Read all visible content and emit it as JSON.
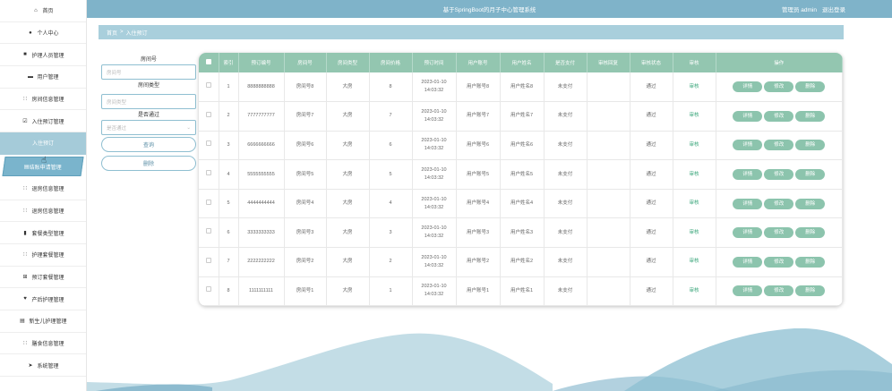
{
  "header": {
    "title": "基于SpringBoot的月子中心管理系统",
    "user_label": "管理员 admin",
    "logout_label": "退出登录"
  },
  "sidebar": {
    "items": [
      {
        "label": "首页",
        "icon": "home-icon"
      },
      {
        "label": "个人中心",
        "icon": "person-icon"
      },
      {
        "label": "护理人员管理",
        "icon": "briefcase-icon"
      },
      {
        "label": "用户管理",
        "icon": "monitor-icon"
      },
      {
        "label": "房间信息管理",
        "icon": "grid-icon"
      },
      {
        "label": "入住预订管理",
        "icon": "check-square-icon"
      },
      {
        "label": "入住预订",
        "icon": ""
      },
      {
        "label": "结账申请管理",
        "icon": "doc-icon"
      },
      {
        "label": "退房信息管理",
        "icon": "grid-icon"
      },
      {
        "label": "退房信息管理",
        "icon": "grid-icon"
      },
      {
        "label": "套餐类型管理",
        "icon": "trash-icon"
      },
      {
        "label": "护理套餐管理",
        "icon": "grid-icon"
      },
      {
        "label": "预订套餐管理",
        "icon": "table-icon"
      },
      {
        "label": "产后护理管理",
        "icon": "heart-icon"
      },
      {
        "label": "新生儿护理管理",
        "icon": "doc-icon"
      },
      {
        "label": "膳食信息管理",
        "icon": "grid-icon"
      },
      {
        "label": "系统管理",
        "icon": "send-icon"
      }
    ]
  },
  "breadcrumb": {
    "home": "首页",
    "sep": ">",
    "current": "入住预订"
  },
  "search": {
    "room_no_label": "房间号",
    "room_no_placeholder": "房间号",
    "room_type_label": "房间类型",
    "room_type_placeholder": "房间类型",
    "approved_label": "是否通过",
    "approved_placeholder": "是否通过",
    "query_button": "查询",
    "delete_button": "删除"
  },
  "table": {
    "columns": [
      "索引",
      "预订编号",
      "房间号",
      "房间类型",
      "房间价格",
      "预订时间",
      "用户账号",
      "用户姓名",
      "是否支付",
      "审核回复",
      "审核状态",
      "审核",
      "操作"
    ],
    "rows": [
      {
        "index": "1",
        "booking_no": "8888888888",
        "room": "房间号8",
        "type": "大房",
        "price": "8",
        "date": "2023-01-10",
        "time": "14:03:32",
        "account": "用户账号8",
        "name": "用户姓名8",
        "paid": "未支付",
        "reply": "",
        "status": "通过",
        "audit": "审核"
      },
      {
        "index": "2",
        "booking_no": "7777777777",
        "room": "房间号7",
        "type": "大房",
        "price": "7",
        "date": "2023-01-10",
        "time": "14:03:32",
        "account": "用户账号7",
        "name": "用户姓名7",
        "paid": "未支付",
        "reply": "",
        "status": "通过",
        "audit": "审核"
      },
      {
        "index": "3",
        "booking_no": "6666666666",
        "room": "房间号6",
        "type": "大房",
        "price": "6",
        "date": "2023-01-10",
        "time": "14:03:32",
        "account": "用户账号6",
        "name": "用户姓名6",
        "paid": "未支付",
        "reply": "",
        "status": "通过",
        "audit": "审核"
      },
      {
        "index": "4",
        "booking_no": "5555555555",
        "room": "房间号5",
        "type": "大房",
        "price": "5",
        "date": "2023-01-10",
        "time": "14:03:32",
        "account": "用户账号5",
        "name": "用户姓名5",
        "paid": "未支付",
        "reply": "",
        "status": "通过",
        "audit": "审核"
      },
      {
        "index": "5",
        "booking_no": "4444444444",
        "room": "房间号4",
        "type": "大房",
        "price": "4",
        "date": "2023-01-10",
        "time": "14:03:32",
        "account": "用户账号4",
        "name": "用户姓名4",
        "paid": "未支付",
        "reply": "",
        "status": "通过",
        "audit": "审核"
      },
      {
        "index": "6",
        "booking_no": "3333333333",
        "room": "房间号3",
        "type": "大房",
        "price": "3",
        "date": "2023-01-10",
        "time": "14:03:32",
        "account": "用户账号3",
        "name": "用户姓名3",
        "paid": "未支付",
        "reply": "",
        "status": "通过",
        "audit": "审核"
      },
      {
        "index": "7",
        "booking_no": "2222222222",
        "room": "房间号2",
        "type": "大房",
        "price": "2",
        "date": "2023-01-10",
        "time": "14:03:32",
        "account": "用户账号2",
        "name": "用户姓名2",
        "paid": "未支付",
        "reply": "",
        "status": "通过",
        "audit": "审核"
      },
      {
        "index": "8",
        "booking_no": "1111111111",
        "room": "房间号1",
        "type": "大房",
        "price": "1",
        "date": "2023-01-10",
        "time": "14:03:32",
        "account": "用户账号1",
        "name": "用户姓名1",
        "paid": "未支付",
        "reply": "",
        "status": "通过",
        "audit": "审核"
      }
    ],
    "actions": [
      "详情",
      "修改",
      "删除"
    ]
  },
  "colors": {
    "header_bg": "#7fb3c9",
    "table_header_bg": "#93c6b0",
    "action_btn_bg": "#8cc4ad",
    "active_sidebar_bg": "#a5cbd9"
  }
}
